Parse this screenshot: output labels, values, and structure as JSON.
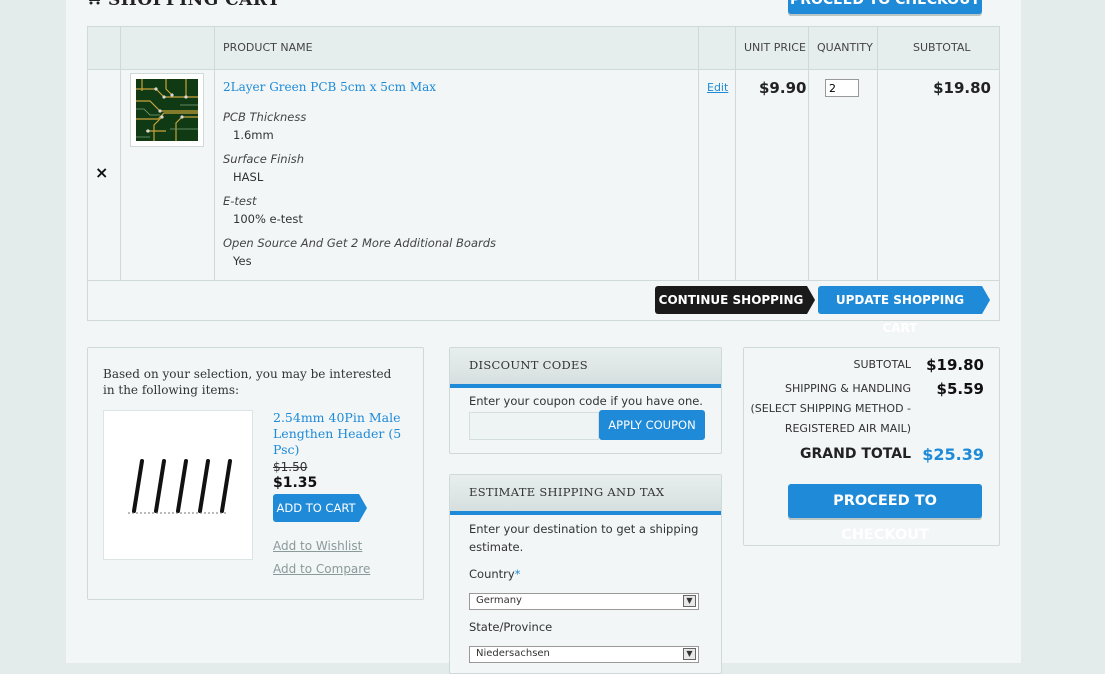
{
  "header": {
    "title": "SHOPPING CART",
    "top_checkout_label": "PROCEED TO CHECKOUT"
  },
  "cart": {
    "columns": {
      "product_name": "PRODUCT NAME",
      "unit_price": "UNIT PRICE",
      "quantity": "QUANTITY",
      "subtotal": "SUBTOTAL"
    },
    "remove_icon": "×",
    "item": {
      "name": "2Layer Green PCB 5cm x 5cm Max",
      "edit_label": "Edit",
      "unit_price": "$9.90",
      "quantity": "2",
      "subtotal": "$19.80",
      "options": [
        {
          "label": "PCB Thickness",
          "value": "1.6mm"
        },
        {
          "label": "Surface Finish",
          "value": "HASL"
        },
        {
          "label": "E-test",
          "value": "100% e-test"
        },
        {
          "label": "Open Source And Get 2 More Additional Boards",
          "value": "Yes"
        }
      ]
    },
    "continue_label": "CONTINUE SHOPPING",
    "update_label": "UPDATE SHOPPING CART"
  },
  "crosssell": {
    "intro": "Based on your selection, you may be interested in the following items:",
    "product_name": "2.54mm 40Pin Male Lengthen Header (5 Psc)",
    "old_price": "$1.50",
    "new_price": "$1.35",
    "add_to_cart": "ADD TO CART",
    "wishlist": "Add to Wishlist",
    "compare": "Add to Compare"
  },
  "discount": {
    "title": "DISCOUNT CODES",
    "text": "Enter your coupon code if you have one.",
    "coupon_value": "",
    "apply_label": "APPLY COUPON"
  },
  "shipping": {
    "title": "ESTIMATE SHIPPING AND TAX",
    "text": "Enter your destination to get a shipping estimate.",
    "country_label": "Country",
    "required_mark": "*",
    "country_value": "Germany",
    "state_label": "State/Province",
    "state_value": "Niedersachsen"
  },
  "totals": {
    "subtotal_label": "SUBTOTAL",
    "subtotal_value": "$19.80",
    "shipping_label": "SHIPPING & HANDLING (SELECT SHIPPING METHOD - REGISTERED AIR MAIL)",
    "shipping_value": "$5.59",
    "grand_total_label": "GRAND TOTAL",
    "grand_total_value": "$25.39",
    "checkout_label": "PROCEED TO CHECKOUT"
  },
  "colors": {
    "accent": "#1e8ad8",
    "dark_button": "#1a1a1a",
    "background": "#e3ebeb",
    "panel": "#f2f6f6"
  }
}
